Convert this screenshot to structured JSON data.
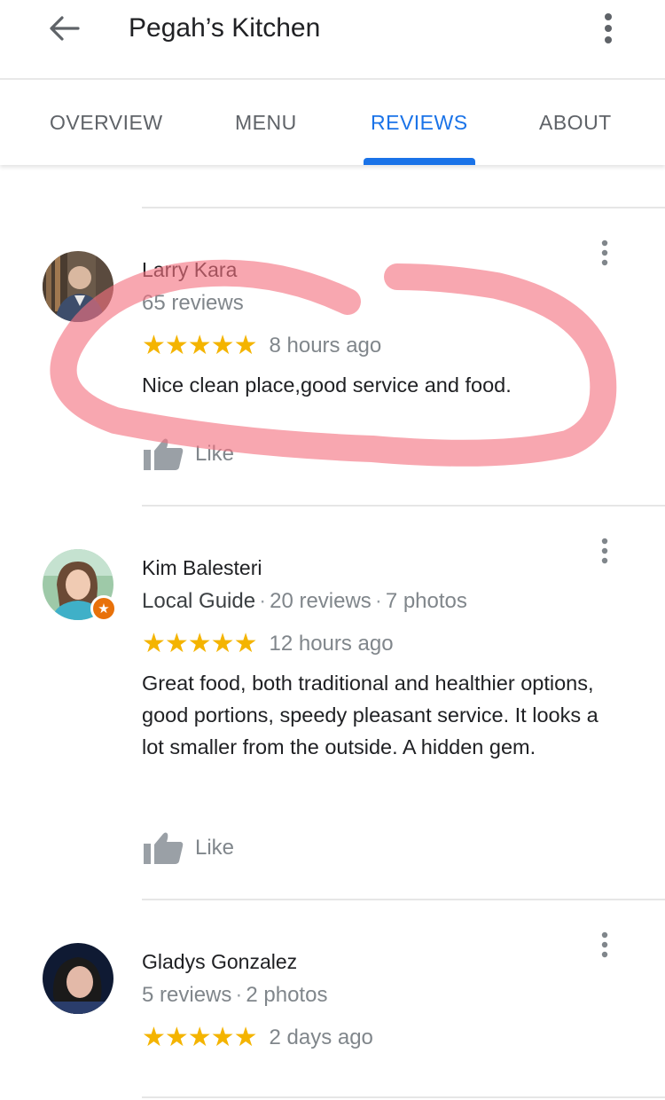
{
  "header": {
    "title": "Pegah’s Kitchen",
    "back_icon": "arrow-back-icon",
    "menu_icon": "more-vert-icon"
  },
  "tabs": [
    {
      "label": "OVERVIEW",
      "active": false
    },
    {
      "label": "MENU",
      "active": false
    },
    {
      "label": "REVIEWS",
      "active": true
    },
    {
      "label": "ABOUT",
      "active": false
    }
  ],
  "colors": {
    "accent": "#1a73e8",
    "star": "#f4b400",
    "highlight_stroke": "#f4717f",
    "local_guide_badge": "#e8710a"
  },
  "reviews": [
    {
      "author": "Larry Kara",
      "local_guide": "",
      "review_count": "65 reviews",
      "photo_count": "",
      "rating": 5,
      "stars": "★★★★★",
      "time": "8 hours ago",
      "text": "Nice clean place,good service and food.",
      "like_label": "Like"
    },
    {
      "author": "Kim Balesteri",
      "local_guide": "Local Guide",
      "review_count": "20 reviews",
      "photo_count": "7 photos",
      "rating": 5,
      "stars": "★★★★★",
      "time": "12 hours ago",
      "text": "Great food, both traditional and healthier options, good portions, speedy pleasant service. It looks a lot smaller from the outside. A hidden gem.",
      "like_label": "Like"
    },
    {
      "author": "Gladys Gonzalez",
      "local_guide": "",
      "review_count": "5 reviews",
      "photo_count": "2 photos",
      "rating": 5,
      "stars": "★★★★★",
      "time": "2 days ago"
    }
  ],
  "separator": "·"
}
